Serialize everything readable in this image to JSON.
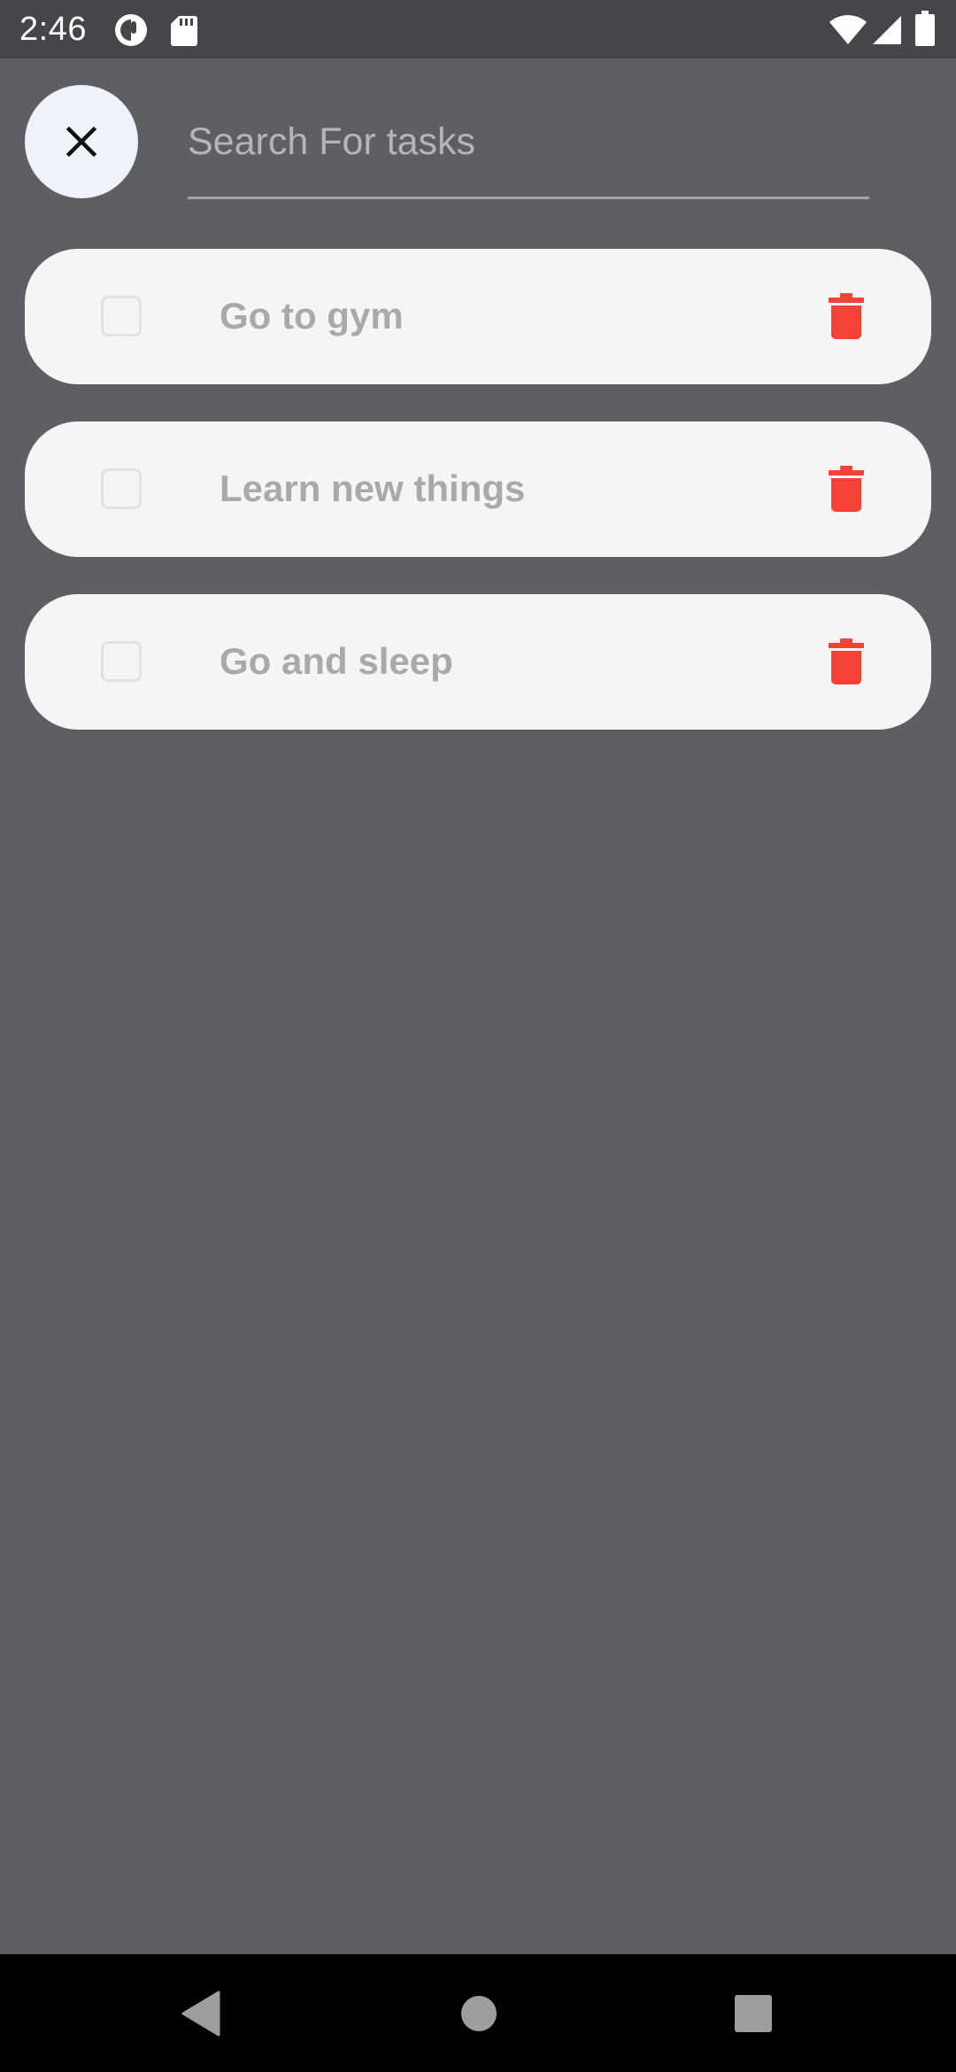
{
  "status_bar": {
    "time": "2:46",
    "icons": [
      "wifi-icon",
      "signal-icon",
      "battery-icon"
    ],
    "notification_icons": [
      "app-notification-icon",
      "sd-card-icon"
    ]
  },
  "search": {
    "placeholder": "Search For tasks",
    "value": "",
    "close_icon": "close-icon"
  },
  "tasks": [
    {
      "label": "Go to gym",
      "checked": false
    },
    {
      "label": "Learn new things",
      "checked": false
    },
    {
      "label": "Go and sleep",
      "checked": false
    }
  ],
  "colors": {
    "background": "#5e5f64",
    "card": "#f5f5f5",
    "delete": "#f44336",
    "task_text": "#a9a9a9"
  },
  "nav_bar": {
    "buttons": [
      "back-icon",
      "home-icon",
      "recents-icon"
    ]
  }
}
